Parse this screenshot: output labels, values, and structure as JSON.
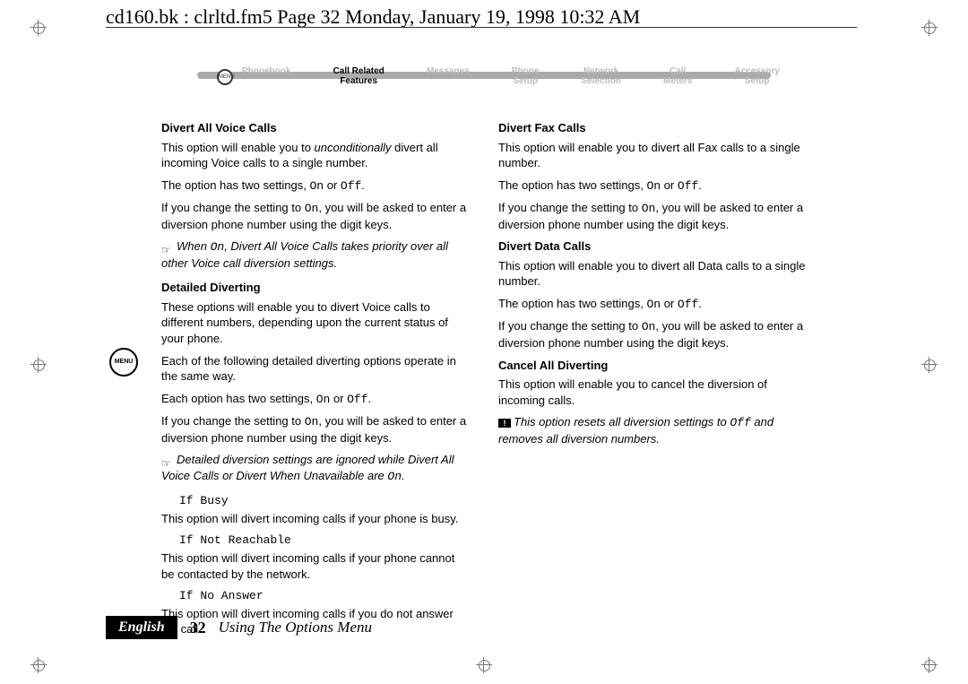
{
  "headline": "cd160.bk : clrltd.fm5  Page 32  Monday, January 19, 1998  10:32 AM",
  "nav": {
    "items": [
      {
        "label": "Phonebook"
      },
      {
        "label": "Call Related\nFeatures",
        "active": true
      },
      {
        "label": "Messages"
      },
      {
        "label": "Phone\nSetup"
      },
      {
        "label": "Network\nSelection"
      },
      {
        "label": "Call\nMeters"
      },
      {
        "label": "Accessory\nSetup"
      }
    ],
    "menu_label": "MENU"
  },
  "left": {
    "h1": "Divert All Voice Calls",
    "p1_a": "This option will enable you to ",
    "p1_em": "unconditionally",
    "p1_b": " divert all incoming Voice calls to a single number.",
    "p2_a": "The option has two settings, ",
    "p2_b": " or ",
    "p2_c": ".",
    "p3_a": "If you change the setting to ",
    "p3_b": ", you will be asked to enter a diversion phone number using the digit keys.",
    "note1_a": "When ",
    "note1_b": ", Divert All Voice Calls takes priority over all other Voice call diversion settings.",
    "h2": "Detailed Diverting",
    "p4": "These options will enable you to divert Voice calls to different numbers, depending upon the current status of your phone.",
    "p5": "Each of the following detailed diverting options operate in the same way.",
    "p6_a": "Each option has two settings, ",
    "p6_b": " or ",
    "p6_c": ".",
    "p7_a": "If you change the setting to ",
    "p7_b": ", you will be asked to enter a diversion phone number using the digit keys.",
    "note2_a": "Detailed diversion settings are ignored while Divert All Voice Calls or Divert When Unavailable are ",
    "note2_b": ".",
    "sub1": "If Busy",
    "sub1_p": "This option will divert incoming calls if your phone is busy.",
    "sub2": "If Not Reachable",
    "sub2_p": "This option will divert incoming calls if your phone cannot be contacted by the network.",
    "sub3": "If No Answer",
    "sub3_p": "This option will divert incoming calls if you do not answer the call."
  },
  "right": {
    "h1": "Divert Fax Calls",
    "p1": "This option will enable you to divert all Fax calls to a single number.",
    "p2_a": "The option has two settings, ",
    "p2_b": " or ",
    "p2_c": ".",
    "p3_a": "If you change the setting to ",
    "p3_b": ", you will be asked to enter a diversion phone number using the digit keys.",
    "h2": "Divert Data Calls",
    "p4": "This option will enable you to divert all Data calls to a single number.",
    "p5_a": "The option has two settings, ",
    "p5_b": " or ",
    "p5_c": ".",
    "p6_a": "If you change the setting to ",
    "p6_b": ", you will be asked to enter a diversion phone number using the digit keys.",
    "h3": "Cancel All Diverting",
    "p7": "This option will enable you to cancel the diversion of incoming calls.",
    "note_a": "This option resets all diversion settings to ",
    "note_b": " and removes all diversion numbers."
  },
  "code": {
    "on": "On",
    "off": "Off"
  },
  "footer": {
    "lang": "English",
    "page": "32",
    "section": "Using The Options Menu"
  }
}
